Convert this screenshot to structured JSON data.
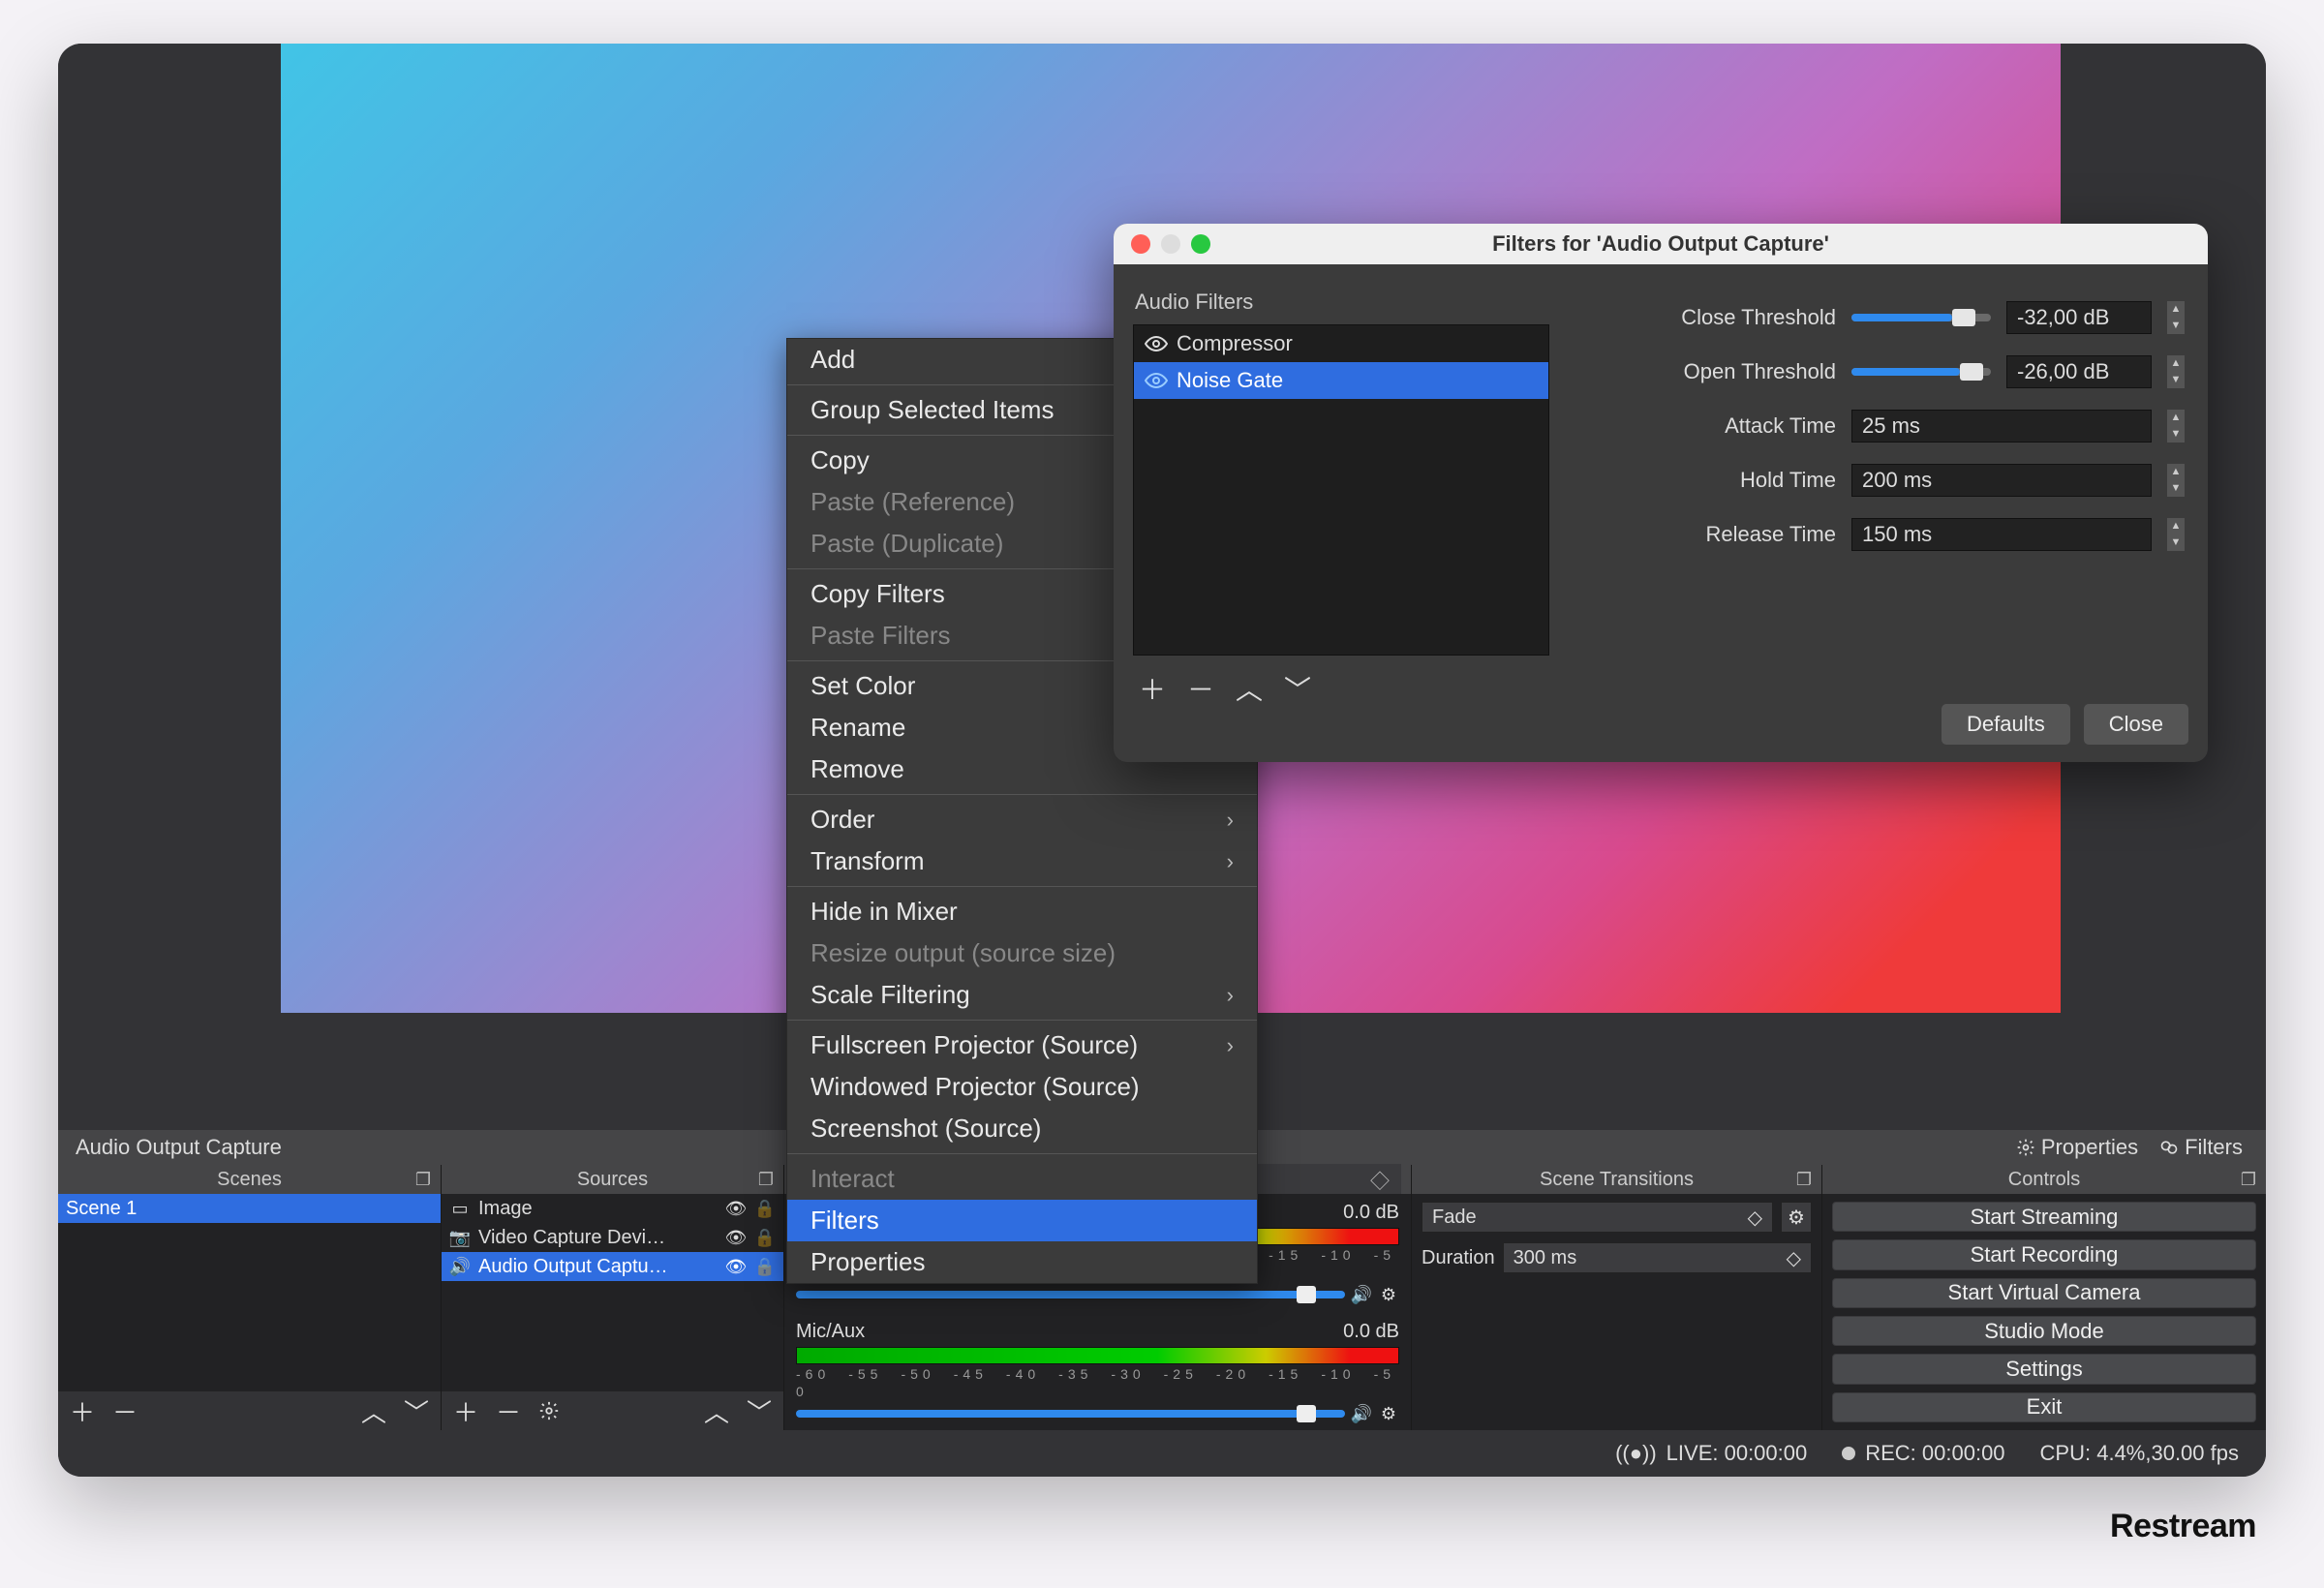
{
  "watermark": "Restream",
  "toolbar": {
    "source_label": "Audio Output Capture",
    "properties_label": "Properties",
    "filters_label": "Filters"
  },
  "context_menu": {
    "add": "Add",
    "group": "Group Selected Items",
    "copy": "Copy",
    "paste_ref": "Paste (Reference)",
    "paste_dup": "Paste (Duplicate)",
    "copy_filters": "Copy Filters",
    "paste_filters": "Paste Filters",
    "set_color": "Set Color",
    "rename": "Rename",
    "remove": "Remove",
    "order": "Order",
    "transform": "Transform",
    "hide_mixer": "Hide in Mixer",
    "resize_output": "Resize output (source size)",
    "scale_filtering": "Scale Filtering",
    "fullscreen_proj": "Fullscreen Projector (Source)",
    "windowed_proj": "Windowed Projector (Source)",
    "screenshot": "Screenshot (Source)",
    "interact": "Interact",
    "filters": "Filters",
    "properties": "Properties"
  },
  "filters_dialog": {
    "title": "Filters for 'Audio Output Capture'",
    "section_label": "Audio Filters",
    "filter_items": [
      "Compressor",
      "Noise Gate"
    ],
    "params": {
      "close_threshold": {
        "label": "Close Threshold",
        "value": "-32,00 dB",
        "percent": 72
      },
      "open_threshold": {
        "label": "Open Threshold",
        "value": "-26,00 dB",
        "percent": 78
      },
      "attack_time": {
        "label": "Attack Time",
        "value": "25 ms"
      },
      "hold_time": {
        "label": "Hold Time",
        "value": "200 ms"
      },
      "release_time": {
        "label": "Release Time",
        "value": "150 ms"
      }
    },
    "defaults_btn": "Defaults",
    "close_btn": "Close"
  },
  "docks": {
    "scenes": {
      "title": "Scenes",
      "items": [
        "Scene 1"
      ]
    },
    "sources": {
      "title": "Sources",
      "items": [
        {
          "label": "Image"
        },
        {
          "label": "Video Capture Devi…"
        },
        {
          "label": "Audio Output Captu…"
        }
      ]
    },
    "mixer": {
      "channels": [
        {
          "name_bind_key": "toolbar.source_label",
          "level": "0.0 dB"
        },
        {
          "name": "Mic/Aux",
          "level": "0.0 dB"
        }
      ]
    },
    "transitions": {
      "title": "Scene Transitions",
      "value": "Fade",
      "duration_label": "Duration",
      "duration_value": "300 ms"
    },
    "controls": {
      "title": "Controls",
      "buttons": [
        "Start Streaming",
        "Start Recording",
        "Start Virtual Camera",
        "Studio Mode",
        "Settings",
        "Exit"
      ]
    }
  },
  "status": {
    "live": "LIVE: 00:00:00",
    "rec": "REC: 00:00:00",
    "cpu": "CPU: 4.4%,30.00 fps"
  }
}
